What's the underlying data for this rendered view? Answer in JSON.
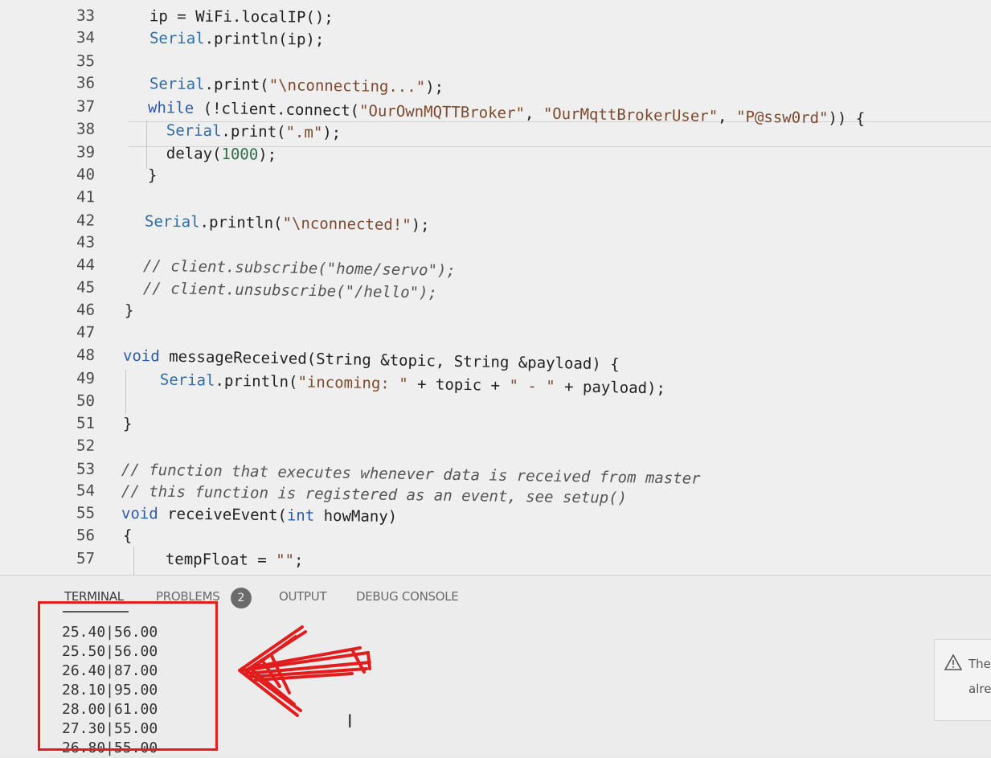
{
  "editor": {
    "lines": [
      {
        "num": "33",
        "segments": [
          {
            "t": "ip = WiFi.localIP();",
            "c": ""
          }
        ]
      },
      {
        "num": "34",
        "segments": [
          {
            "t": "Serial",
            "c": "typ"
          },
          {
            "t": ".println(ip);",
            "c": ""
          }
        ]
      },
      {
        "num": "35",
        "segments": []
      },
      {
        "num": "36",
        "segments": [
          {
            "t": "Serial",
            "c": "typ"
          },
          {
            "t": ".print(",
            "c": ""
          },
          {
            "t": "\"\\nconnecting...\"",
            "c": "str"
          },
          {
            "t": ");",
            "c": ""
          }
        ]
      },
      {
        "num": "37",
        "segments": [
          {
            "t": "while",
            "c": "kw"
          },
          {
            "t": " (!client.connect(",
            "c": ""
          },
          {
            "t": "\"OurOwnMQTTBroker\"",
            "c": "str"
          },
          {
            "t": ", ",
            "c": ""
          },
          {
            "t": "\"OurMqttBrokerUser\"",
            "c": "str"
          },
          {
            "t": ", ",
            "c": ""
          },
          {
            "t": "\"P@ssw0rd\"",
            "c": "str"
          },
          {
            "t": ")) {",
            "c": ""
          }
        ]
      },
      {
        "num": "38",
        "segments": [
          {
            "t": "  Serial",
            "c": "typ"
          },
          {
            "t": ".print(",
            "c": ""
          },
          {
            "t": "\".m\"",
            "c": "str"
          },
          {
            "t": ");",
            "c": ""
          }
        ]
      },
      {
        "num": "39",
        "segments": [
          {
            "t": "  delay(",
            "c": ""
          },
          {
            "t": "1000",
            "c": "num"
          },
          {
            "t": ");",
            "c": ""
          }
        ]
      },
      {
        "num": "40",
        "segments": [
          {
            "t": "}",
            "c": ""
          }
        ]
      },
      {
        "num": "41",
        "segments": []
      },
      {
        "num": "42",
        "segments": [
          {
            "t": "Serial",
            "c": "typ"
          },
          {
            "t": ".println(",
            "c": ""
          },
          {
            "t": "\"\\nconnected!\"",
            "c": "str"
          },
          {
            "t": ");",
            "c": ""
          }
        ]
      },
      {
        "num": "43",
        "segments": []
      },
      {
        "num": "44",
        "segments": [
          {
            "t": "// client.subscribe(\"home/servo\");",
            "c": "cmt"
          }
        ]
      },
      {
        "num": "45",
        "segments": [
          {
            "t": "// client.unsubscribe(\"/hello\");",
            "c": "cmt"
          }
        ]
      },
      {
        "num": "46",
        "segments": [
          {
            "t": "}",
            "c": ""
          }
        ]
      },
      {
        "num": "47",
        "segments": []
      },
      {
        "num": "48",
        "segments": [
          {
            "t": "void",
            "c": "kw"
          },
          {
            "t": " messageReceived(String &topic, String &payload) {",
            "c": ""
          }
        ]
      },
      {
        "num": "49",
        "segments": [
          {
            "t": "  Serial",
            "c": "typ"
          },
          {
            "t": ".println(",
            "c": ""
          },
          {
            "t": "\"incoming: \"",
            "c": "str"
          },
          {
            "t": " + topic + ",
            "c": ""
          },
          {
            "t": "\" - \"",
            "c": "str"
          },
          {
            "t": " + payload);",
            "c": ""
          }
        ]
      },
      {
        "num": "50",
        "segments": []
      },
      {
        "num": "51",
        "segments": [
          {
            "t": "}",
            "c": ""
          }
        ]
      },
      {
        "num": "52",
        "segments": []
      },
      {
        "num": "53",
        "segments": [
          {
            "t": "// function that executes whenever data is received from master",
            "c": "cmt"
          }
        ]
      },
      {
        "num": "54",
        "segments": [
          {
            "t": "// this function is registered as an event, see setup()",
            "c": "cmt"
          }
        ]
      },
      {
        "num": "55",
        "segments": [
          {
            "t": "void",
            "c": "kw"
          },
          {
            "t": " receiveEvent(",
            "c": ""
          },
          {
            "t": "int",
            "c": "kw"
          },
          {
            "t": " howMany)",
            "c": ""
          }
        ]
      },
      {
        "num": "56",
        "segments": [
          {
            "t": "{",
            "c": ""
          }
        ]
      },
      {
        "num": "57",
        "segments": [
          {
            "t": "  tempFloat = ",
            "c": ""
          },
          {
            "t": "\"\"",
            "c": "str"
          },
          {
            "t": ";",
            "c": ""
          }
        ]
      }
    ]
  },
  "panel": {
    "tabs": [
      {
        "label": "TERMINAL",
        "active": true
      },
      {
        "label": "PROBLEMS",
        "active": false
      },
      {
        "label": "OUTPUT",
        "active": false
      },
      {
        "label": "DEBUG CONSOLE",
        "active": false
      }
    ],
    "problems_count": "2",
    "terminal_lines": [
      "25.40|56.00",
      "25.50|56.00",
      "26.40|87.00",
      "28.10|95.00",
      "28.00|61.00",
      "27.30|55.00",
      "26.80|55.00"
    ]
  },
  "notification": {
    "line1": "The",
    "line2": "alre"
  },
  "colors": {
    "annotation_red": "#e21d1d"
  }
}
